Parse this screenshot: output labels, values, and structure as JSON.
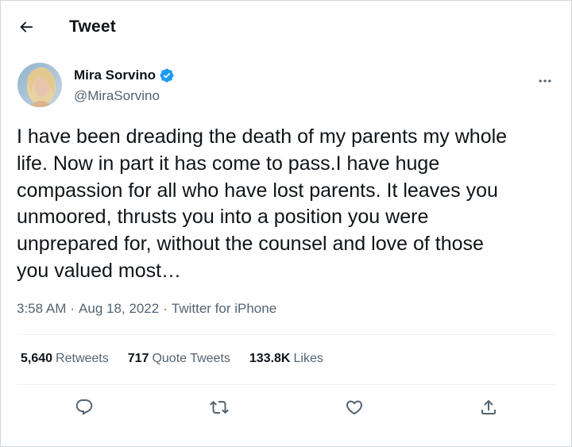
{
  "header": {
    "title": "Tweet",
    "back_icon": "arrow-left-icon"
  },
  "author": {
    "name": "Mira Sorvino",
    "handle": "@MiraSorvino",
    "verified": true,
    "verified_color": "#1d9bf0",
    "more_icon": "more-horizontal-icon"
  },
  "tweet": {
    "text": "I have been dreading the death of my parents my whole\nlife. Now in part it has come to pass.I have huge\ncompassion for all who have lost parents. It leaves you\nunmoored, thrusts you into a position you were\nunprepared for, without the counsel and love of those\nyou valued most…",
    "time": "3:58 AM",
    "date": "Aug 18, 2022",
    "source": "Twitter for iPhone",
    "separator": "·"
  },
  "stats": {
    "retweets_count": "5,640",
    "retweets_label": "Retweets",
    "quotes_count": "717",
    "quotes_label": "Quote Tweets",
    "likes_count": "133.8K",
    "likes_label": "Likes"
  },
  "actions": [
    {
      "icon": "reply-icon"
    },
    {
      "icon": "retweet-icon"
    },
    {
      "icon": "like-icon"
    },
    {
      "icon": "share-icon"
    }
  ],
  "colors": {
    "text": "#0f1419",
    "secondary": "#536471",
    "border": "#cfd9de",
    "divider": "#eff3f4",
    "accent": "#1d9bf0"
  }
}
